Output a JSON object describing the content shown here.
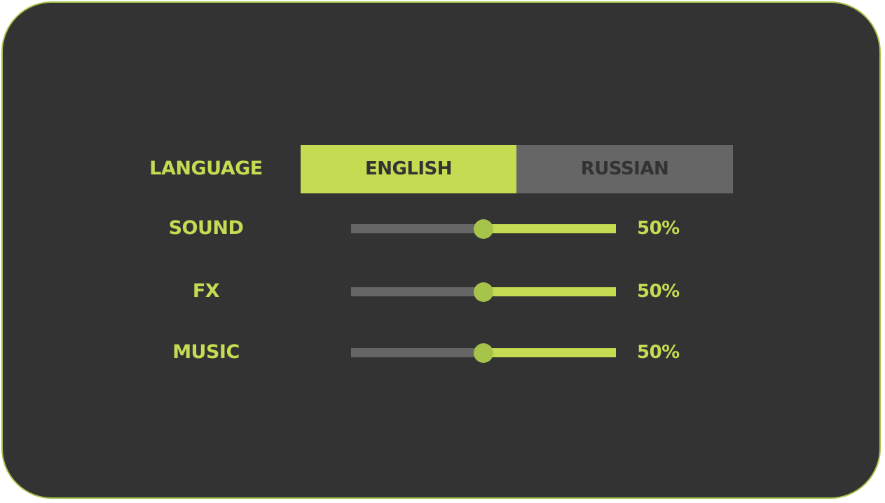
{
  "language": {
    "label": "LANGUAGE",
    "options": [
      "ENGLISH",
      "RUSSIAN"
    ],
    "selected": "ENGLISH"
  },
  "sliders": [
    {
      "label": "SOUND",
      "value": 0.5,
      "value_text": "50%"
    },
    {
      "label": "FX",
      "value": 0.5,
      "value_text": "50%"
    },
    {
      "label": "MUSIC",
      "value": 0.5,
      "value_text": "50%"
    }
  ],
  "colors": {
    "background": "#333333",
    "accent": "#c5dc52",
    "accent_dark": "#a6c34a",
    "inactive": "#666666"
  }
}
